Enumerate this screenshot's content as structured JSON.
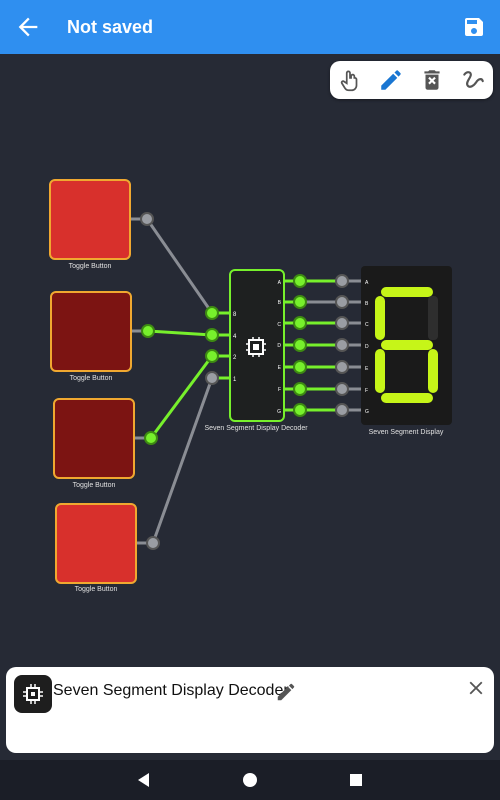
{
  "app_bar": {
    "title": "Not saved",
    "back_icon": "arrow-left-icon",
    "save_icon": "floppy-disk-icon"
  },
  "toolbox": {
    "tools": [
      {
        "icon": "hand-pointer-icon"
      },
      {
        "icon": "pencil-icon"
      },
      {
        "icon": "delete-icon"
      },
      {
        "icon": "wire-icon"
      }
    ]
  },
  "circuit": {
    "toggle_label": "Toggle Button",
    "decoder": {
      "label": "Seven Segment Display Decoder",
      "inputs": [
        "8",
        "4",
        "2",
        "1"
      ],
      "outputs": [
        "A",
        "B",
        "C",
        "D",
        "E",
        "F",
        "G"
      ]
    },
    "display": {
      "label": "Seven Segment Display",
      "inputs": [
        "A",
        "B",
        "C",
        "D",
        "E",
        "F",
        "G"
      ]
    },
    "toggles": [
      {
        "state": "on"
      },
      {
        "state": "off"
      },
      {
        "state": "off"
      },
      {
        "state": "on"
      }
    ],
    "colors": {
      "wire_active": "#77f02c",
      "wire_inactive": "#8a8d94",
      "toggle_on": "#d8302c",
      "toggle_off": "#7c1412",
      "toggle_border": "#f0a830",
      "segment_on": "#c6f518",
      "segment_off": "#2e2e2e"
    }
  },
  "bottom_card": {
    "title": "Seven Segment Display Decoder",
    "chip_icon": "chip-icon",
    "edit_icon": "pencil-icon",
    "close_icon": "close-icon"
  },
  "nav_bar": {
    "back": "triangle-back-icon",
    "home": "circle-home-icon",
    "recents": "square-recents-icon"
  }
}
